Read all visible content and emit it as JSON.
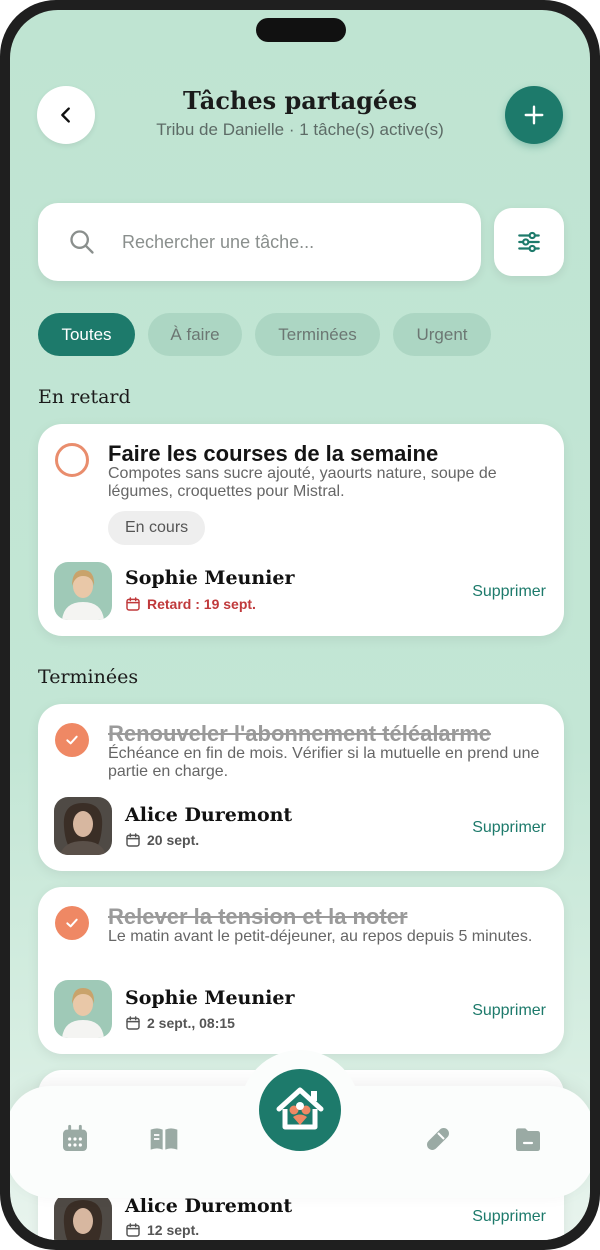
{
  "header": {
    "title": "Tâches partagées",
    "subtitle": "Tribu de Danielle · 1 tâche(s) active(s)"
  },
  "search": {
    "placeholder": "Rechercher une tâche..."
  },
  "filters": [
    "Toutes",
    "À faire",
    "Terminées",
    "Urgent"
  ],
  "active_filter": "Toutes",
  "sections": {
    "overdue": "En retard",
    "done": "Terminées"
  },
  "tasks": [
    {
      "title": "Faire les courses de la semaine",
      "description": "Compotes sans sucre ajouté, yaourts nature, soupe de légumes, croquettes pour Mistral.",
      "status": "En cours",
      "assignee": "Sophie Meunier",
      "date": "Retard : 19 sept.",
      "delete_label": "Supprimer",
      "done": false
    },
    {
      "title": "Renouveler l'abonnement téléalarme",
      "description": "Échéance en fin de mois. Vérifier si la mutuelle en prend une partie en charge.",
      "assignee": "Alice Duremont",
      "date": "20 sept.",
      "delete_label": "Supprimer",
      "done": true
    },
    {
      "title": "Relever la tension et la noter",
      "description": "Le matin avant le petit-déjeuner, au repos depuis 5 minutes.",
      "assignee": "Sophie Meunier",
      "date": "2 sept., 08:15",
      "delete_label": "Supprimer",
      "done": true
    },
    {
      "assignee": "Alice Duremont",
      "date": "12 sept.",
      "delete_label": "Supprimer",
      "done": true
    }
  ],
  "nav": {
    "items": [
      "calendar-icon",
      "book-icon",
      "home-family-icon",
      "pill-icon",
      "folder-icon"
    ]
  },
  "colors": {
    "accent": "#1d7a6b",
    "check": "#ef8864",
    "late": "#c0393b",
    "background": "#bfe4d2"
  }
}
